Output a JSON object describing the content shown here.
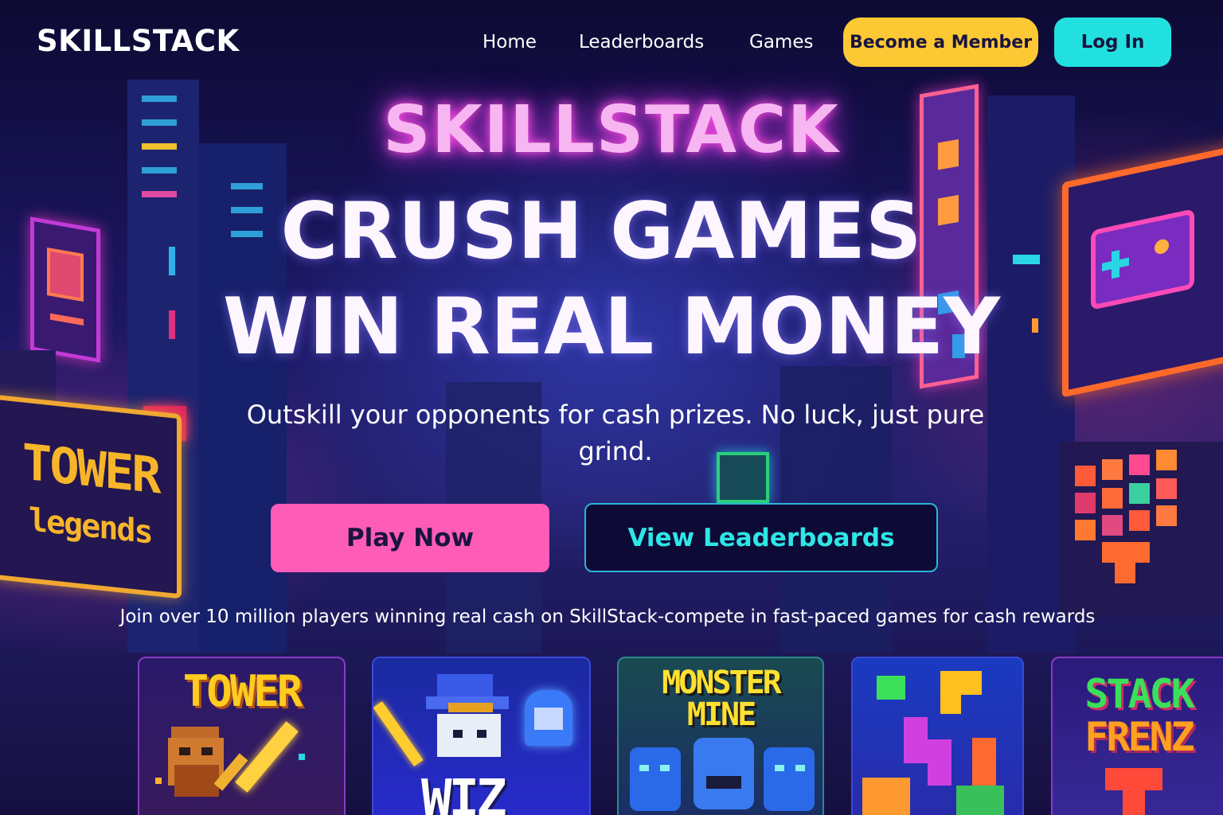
{
  "nav": {
    "logo": "SKILLSTACK",
    "links": [
      "Home",
      "Leaderboards",
      "Games"
    ],
    "become_member": "Become a Member",
    "login": "Log In"
  },
  "hero": {
    "brand": "SKILLSTACK",
    "title_line1": "CRUSH GAMES",
    "title_line2": "WIN REAL MONEY",
    "subtitle": "Outskill your opponents for cash prizes. No luck, just pure grind.",
    "play_button": "Play Now",
    "leaderboards_button": "View Leaderboards",
    "tagline": "Join over 10 million players winning real cash on SkillStack-compete in fast-paced games for cash rewards"
  },
  "background_signs": {
    "tower_sign_line1": "TOWER",
    "tower_sign_line2": "legends"
  },
  "games": [
    {
      "title": "TOWER",
      "icon": "warrior-with-sword"
    },
    {
      "title": "WIZ",
      "icon": "wizard-and-ghost"
    },
    {
      "title_line1": "MONSTER",
      "title_line2": "MINE",
      "icon": "blue-monsters"
    },
    {
      "title": "",
      "icon": "falling-blocks"
    },
    {
      "title_line1": "STACK",
      "title_line2": "FRENZ",
      "icon": "stacked-blocks"
    }
  ],
  "colors": {
    "accent_yellow": "#fcc934",
    "accent_cyan": "#22e0e0",
    "accent_pink": "#ff5cb8",
    "brand_glow": "#f7b6f2",
    "background": "#120c3a"
  }
}
